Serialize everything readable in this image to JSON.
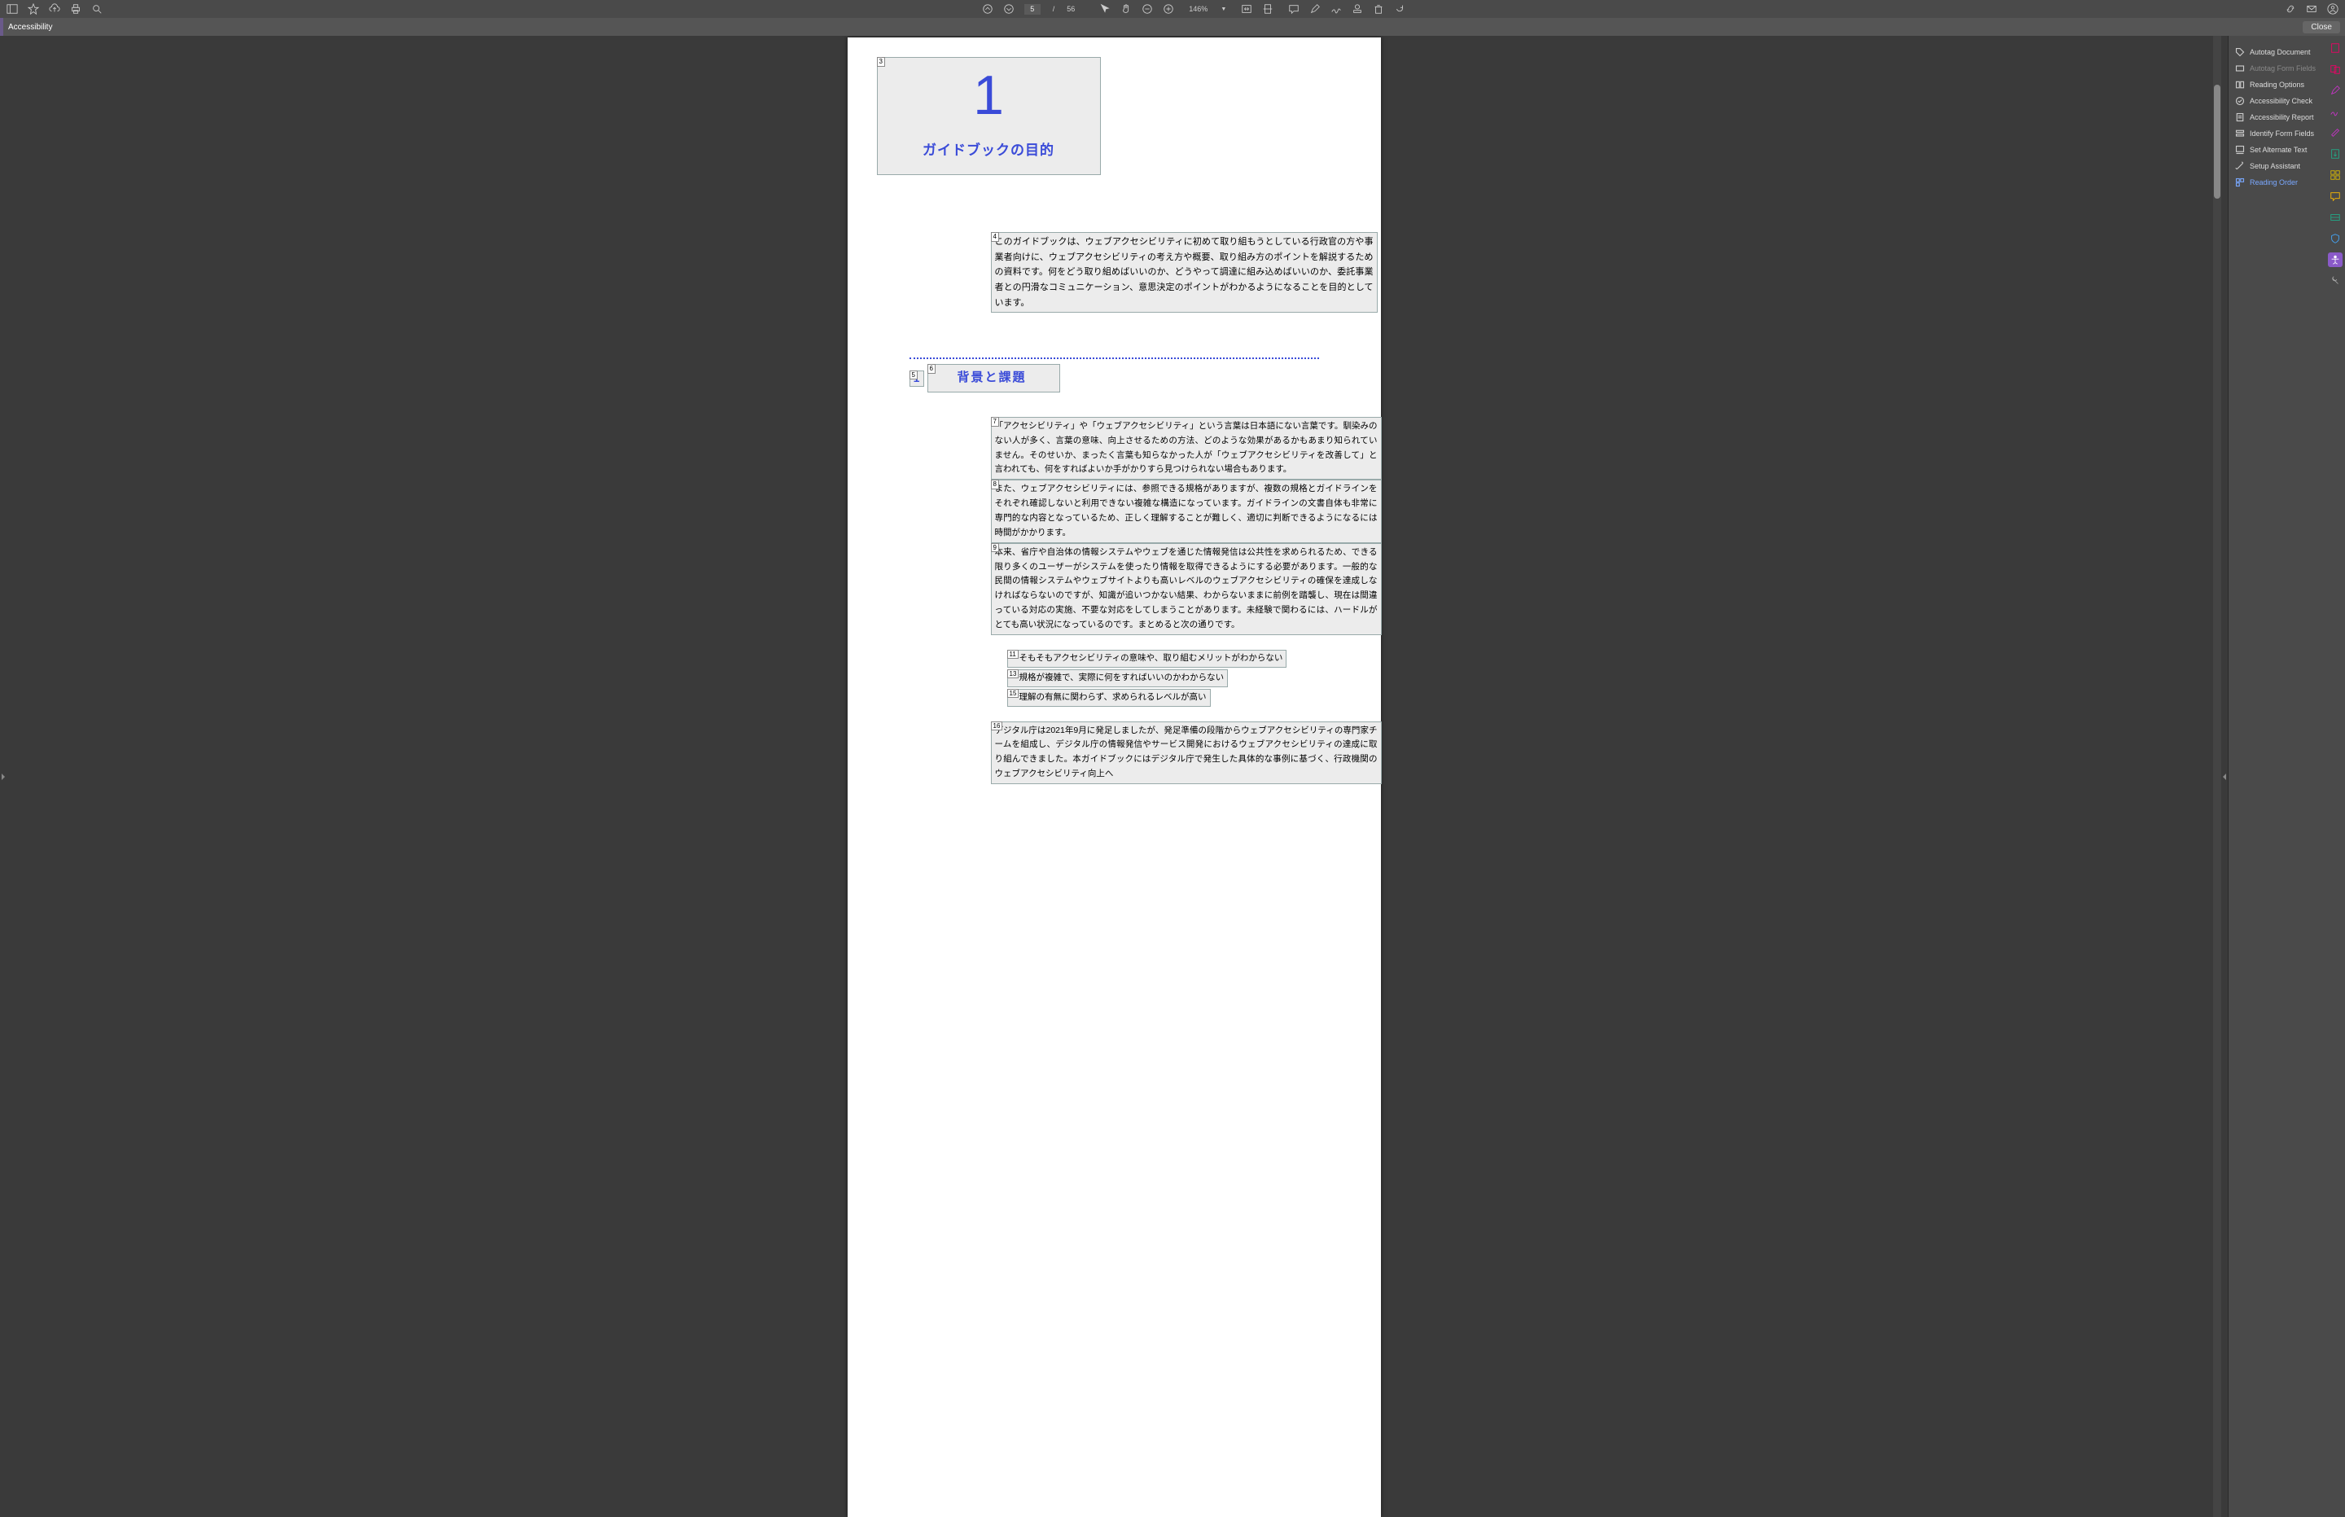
{
  "toolbar": {
    "current_page": "5",
    "total_pages": "56",
    "zoom": "146%"
  },
  "accessibility_bar": {
    "title": "Accessibility",
    "close": "Close"
  },
  "panel": {
    "items": [
      {
        "label": "Autotag Document",
        "state": "normal"
      },
      {
        "label": "Autotag Form Fields",
        "state": "disabled"
      },
      {
        "label": "Reading Options",
        "state": "normal"
      },
      {
        "label": "Accessibility Check",
        "state": "normal"
      },
      {
        "label": "Accessibility Report",
        "state": "normal"
      },
      {
        "label": "Identify Form Fields",
        "state": "normal"
      },
      {
        "label": "Set Alternate Text",
        "state": "normal"
      },
      {
        "label": "Setup Assistant",
        "state": "normal"
      },
      {
        "label": "Reading Order",
        "state": "active"
      }
    ]
  },
  "doc": {
    "chapter_tag": "3",
    "chapter_number": "1",
    "chapter_title": "ガイドブックの目的",
    "intro_tag": "4",
    "intro_text": "このガイドブックは、ウェブアクセシビリティに初めて取り組もうとしている行政官の方や事業者向けに、ウェブアクセシビリティの考え方や概要、取り組み方のポイントを解説するための資料です。何をどう取り組めばいいのか、どうやって調達に組み込めばいいのか、委託事業者との円滑なコミュニケーション、意思決定のポイントがわかるようになることを目的としています。",
    "sub_num_tag": "5",
    "sub_num": "1",
    "sub_title_tag": "6",
    "sub_title": "背景と課題",
    "p1_tag": "7",
    "p1": "「アクセシビリティ」や「ウェブアクセシビリティ」という言葉は日本語にない言葉です。馴染みのない人が多く、言葉の意味、向上させるための方法、どのような効果があるかもあまり知られていません。そのせいか、まったく言葉も知らなかった人が「ウェブアクセシビリティを改善して」と言われても、何をすればよいか手がかりすら見つけられない場合もあります。",
    "p2_tag": "8",
    "p2": "また、ウェブアクセシビリティには、参照できる規格がありますが、複数の規格とガイドラインをそれぞれ確認しないと利用できない複雑な構造になっています。ガイドラインの文書自体も非常に専門的な内容となっているため、正しく理解することが難しく、適切に判断できるようになるには時間がかかります。",
    "p3_tag": "9",
    "p3": "本来、省庁や自治体の情報システムやウェブを通じた情報発信は公共性を求められるため、できる限り多くのユーザーがシステムを使ったり情報を取得できるようにする必要があります。一般的な民間の情報システムやウェブサイトよりも高いレベルのウェブアクセシビリティの確保を達成しなければならないのですが、知識が追いつかない結果、わからないままに前例を踏襲し、現在は間違っている対応の実施、不要な対応をしてしまうことがあります。未経験で関わるには、ハードルがとても高い状況になっているのです。まとめると次の通りです。",
    "b1_tag": "11",
    "b1": "そもそもアクセシビリティの意味や、取り組むメリットがわからない",
    "b2_tag": "13",
    "b2": "規格が複雑で、実際に何をすればいいのかわからない",
    "b3_tag": "15",
    "b3": "理解の有無に関わらず、求められるレベルが高い",
    "closing_tag": "16",
    "closing": "デジタル庁は2021年9月に発足しましたが、発足準備の段階からウェブアクセシビリティの専門家チームを組成し、デジタル庁の情報発信やサービス開発におけるウェブアクセシビリティの達成に取り組んできました。本ガイドブックにはデジタル庁で発生した具体的な事例に基づく、行政機関のウェブアクセシビリティ向上へ"
  }
}
